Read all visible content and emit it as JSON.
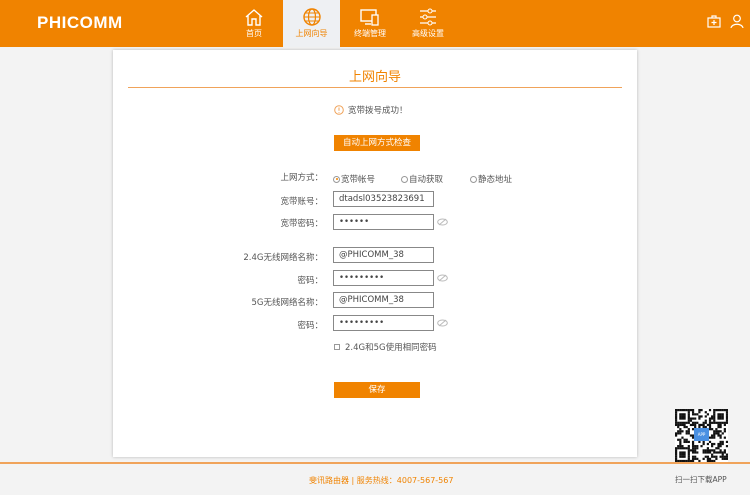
{
  "header": {
    "logo": "PHICOMM",
    "nav": [
      {
        "label": "首页",
        "icon": "home-icon"
      },
      {
        "label": "上网向导",
        "icon": "globe-icon",
        "active": true
      },
      {
        "label": "终端管理",
        "icon": "devices-icon"
      },
      {
        "label": "高级设置",
        "icon": "sliders-icon"
      }
    ],
    "right_icons": [
      "toolbox-icon",
      "user-icon"
    ]
  },
  "accent": "#f08300",
  "page": {
    "title": "上网向导",
    "status": "宽带拨号成功！",
    "auto_detect_button": "自动上网方式检查",
    "mode_label": "上网方式：",
    "modes": [
      {
        "label": "宽带帐号",
        "selected": true
      },
      {
        "label": "自动获取",
        "selected": false
      },
      {
        "label": "静态地址",
        "selected": false
      }
    ],
    "account_label": "宽带账号：",
    "account_value": "dtadsl03523823691",
    "bb_password_label": "宽带密码：",
    "bb_password_value": "••••••",
    "ssid24_label": "2.4G无线网络名称：",
    "ssid24_value": "@PHICOMM_38",
    "pw24_label": "密码：",
    "pw24_value": "•••••••••",
    "ssid5_label": "5G无线网络名称：",
    "ssid5_value": "@PHICOMM_38",
    "pw5_label": "密码：",
    "pw5_value": "•••••••••",
    "same_pw_label": "2.4G和5G使用相同密码",
    "same_pw_checked": false,
    "save_button": "保存"
  },
  "footer": {
    "text": "斐讯路由器 | 服务热线：4007-567-567",
    "qr_caption": "扫一扫下载APP",
    "qr_badge": "APP"
  }
}
